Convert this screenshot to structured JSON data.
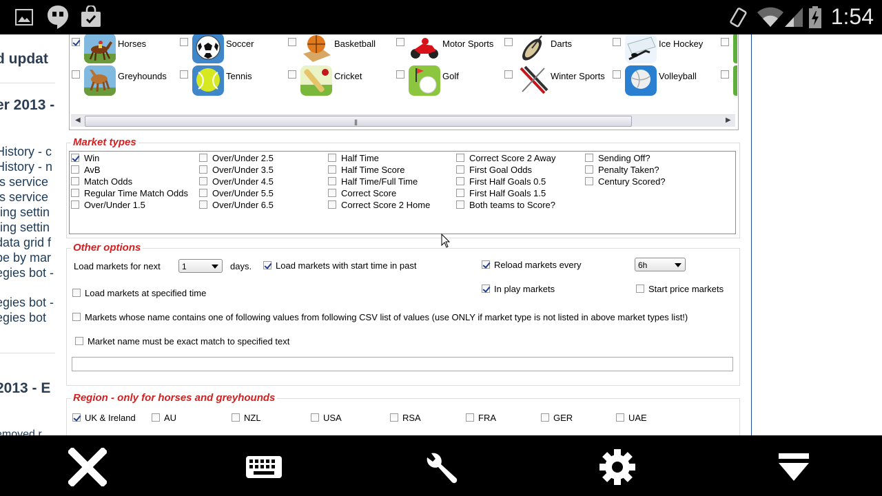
{
  "status_bar": {
    "time": "1:54"
  },
  "background_page": {
    "lines": [
      "d updat",
      "er 2013 -",
      "History - c",
      "History - n",
      "ts service",
      "ts service",
      "ring settin",
      "ring settin",
      "data grid f",
      "pe by mar",
      "egies bot -",
      "egies bot -",
      "egies bot",
      "2013 - E",
      "emoved r"
    ]
  },
  "sports": [
    {
      "label": "Horses",
      "checked": true,
      "icon": "horse-icon"
    },
    {
      "label": "Soccer",
      "checked": false,
      "icon": "soccer-ball-icon"
    },
    {
      "label": "Basketball",
      "checked": false,
      "icon": "basketball-icon"
    },
    {
      "label": "Motor Sports",
      "checked": false,
      "icon": "motorbike-icon"
    },
    {
      "label": "Darts",
      "checked": false,
      "icon": "dartboard-icon"
    },
    {
      "label": "Ice Hockey",
      "checked": false,
      "icon": "ice-hockey-icon"
    },
    {
      "label": "Greyhounds",
      "checked": false,
      "icon": "greyhound-icon"
    },
    {
      "label": "Tennis",
      "checked": false,
      "icon": "tennis-ball-icon"
    },
    {
      "label": "Cricket",
      "checked": false,
      "icon": "cricket-bat-icon"
    },
    {
      "label": "Golf",
      "checked": false,
      "icon": "golf-ball-icon"
    },
    {
      "label": "Winter Sports",
      "checked": false,
      "icon": "skis-icon"
    },
    {
      "label": "Volleyball",
      "checked": false,
      "icon": "volleyball-icon"
    }
  ],
  "market_types": {
    "title": "Market types",
    "items": [
      {
        "label": "Win",
        "checked": true
      },
      {
        "label": "AvB",
        "checked": false
      },
      {
        "label": "Match Odds",
        "checked": false
      },
      {
        "label": "Regular Time Match Odds",
        "checked": false
      },
      {
        "label": "Over/Under 1.5",
        "checked": false
      },
      {
        "label": "Over/Under 2.5",
        "checked": false
      },
      {
        "label": "Over/Under 3.5",
        "checked": false
      },
      {
        "label": "Over/Under 4.5",
        "checked": false
      },
      {
        "label": "Over/Under 5.5",
        "checked": false
      },
      {
        "label": "Over/Under 6.5",
        "checked": false
      },
      {
        "label": "Half Time",
        "checked": false
      },
      {
        "label": "Half Time Score",
        "checked": false
      },
      {
        "label": "Half Time/Full Time",
        "checked": false
      },
      {
        "label": "Correct Score",
        "checked": false
      },
      {
        "label": "Correct Score 2 Home",
        "checked": false
      },
      {
        "label": "Correct Score 2 Away",
        "checked": false
      },
      {
        "label": "First Goal Odds",
        "checked": false
      },
      {
        "label": "First Half Goals 0.5",
        "checked": false
      },
      {
        "label": "First Half Goals 1.5",
        "checked": false
      },
      {
        "label": "Both teams to Score?",
        "checked": false
      },
      {
        "label": "Sending Off?",
        "checked": false
      },
      {
        "label": "Penalty Taken?",
        "checked": false
      },
      {
        "label": "Century Scored?",
        "checked": false
      }
    ]
  },
  "other_options": {
    "title": "Other options",
    "load_next_label": "Load markets for next",
    "days_value": "1",
    "days_label": "days.",
    "load_past_label": "Load markets with start time in past",
    "load_past_checked": true,
    "reload_label": "Reload markets every",
    "reload_checked": true,
    "reload_value": "6h",
    "in_play_label": "In play markets",
    "in_play_checked": true,
    "start_price_label": "Start price markets",
    "start_price_checked": false,
    "specified_time_label": "Load markets at specified time",
    "csv_label": "Markets whose name contains one of following values from following CSV list of values (use ONLY if market type is not listed in above market types list!)",
    "exact_match_label": "Market name must be exact match to specified text",
    "csv_value": ""
  },
  "region": {
    "title": "Region - only for horses and greyhounds",
    "items": [
      {
        "label": "UK & Ireland",
        "checked": true
      },
      {
        "label": "AU",
        "checked": false
      },
      {
        "label": "NZL",
        "checked": false
      },
      {
        "label": "USA",
        "checked": false
      },
      {
        "label": "RSA",
        "checked": false
      },
      {
        "label": "FRA",
        "checked": false
      },
      {
        "label": "GER",
        "checked": false
      },
      {
        "label": "UAE",
        "checked": false
      }
    ]
  }
}
